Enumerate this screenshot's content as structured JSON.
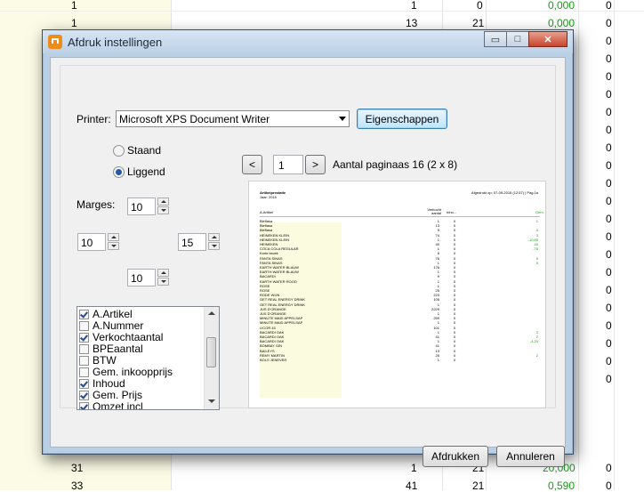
{
  "background": {
    "top_row": {
      "a": "1",
      "b": "1",
      "c": "0",
      "d": "0,000",
      "e": "0"
    },
    "row2": {
      "a": "1",
      "b": "13",
      "c": "21",
      "d": "0,000",
      "e": "0"
    },
    "right_zeros": [
      "0",
      "0",
      "0",
      "0",
      "0",
      "0",
      "0",
      "0",
      "0",
      "0",
      "0",
      "0",
      "0",
      "0",
      "0",
      "0",
      "0",
      "0",
      "0",
      "0"
    ],
    "bottom_row1": {
      "a": "31",
      "b": "1",
      "c": "21",
      "d": "20,000",
      "e": "0"
    },
    "bottom_row2": {
      "a": "33",
      "b": "41",
      "c": "21",
      "d": "0,590",
      "e": "0"
    },
    "green_color": "#1a9a1a"
  },
  "dialog": {
    "title": "Afdruk instellingen",
    "window_buttons": {
      "minimize": "▭",
      "maximize": "□",
      "close": "✕"
    },
    "printer_label": "Printer:",
    "printer_value": "Microsoft XPS Document Writer",
    "properties_button": "Eigenschappen",
    "orientation": {
      "portrait": "Staand",
      "landscape": "Liggend",
      "selected": "Liggend"
    },
    "margins_label": "Marges:",
    "margins": {
      "top": "10",
      "left": "10",
      "right": "15",
      "bottom": "10"
    },
    "columns": [
      {
        "label": "A.Artikel",
        "checked": true
      },
      {
        "label": "A.Nummer",
        "checked": false
      },
      {
        "label": "Verkochtaantal",
        "checked": true
      },
      {
        "label": "BPEaantal",
        "checked": false
      },
      {
        "label": "BTW",
        "checked": false
      },
      {
        "label": "Gem. inkoopprijs",
        "checked": false
      },
      {
        "label": "Inhoud",
        "checked": true
      },
      {
        "label": "Gem. Prijs",
        "checked": true
      },
      {
        "label": "Omzet incl",
        "checked": true
      }
    ],
    "pager": {
      "prev": "<",
      "page": "1",
      "next": ">",
      "page_count_text": "Aantal paginaas 16 (2 x 8)"
    },
    "print_button": "Afdrukken",
    "cancel_button": "Annuleren"
  },
  "preview": {
    "title": "Artikelprestatie",
    "subtitle": "Jaar: 2015",
    "header_right": "Afgedrukt op: 07-09-2015 (12:57) | Pag.1a",
    "col_article": "A.Artikel",
    "col_sold": "Verkocht aantal",
    "col_content": "Inho...",
    "col_avg": "Gem.",
    "rows": [
      {
        "name": "Bieflasa",
        "sold": "1",
        "content": "0",
        "avg": "1"
      },
      {
        "name": "Bieflasa",
        "sold": "13",
        "content": "0",
        "avg": ""
      },
      {
        "name": "Bieflasa",
        "sold": "5",
        "content": "0",
        "avg": "-3"
      },
      {
        "name": "HEINEKEN KLEIN",
        "sold": "74",
        "content": "0",
        "avg": "3"
      },
      {
        "name": "HEINEKEN KLEIN",
        "sold": "1",
        "content": "0",
        "avg": "-10.85"
      },
      {
        "name": "HEINEKEN",
        "sold": "40",
        "content": "0",
        "avg": "-40"
      },
      {
        "name": "COCA COLA REGULAR",
        "sold": "1",
        "content": "0",
        "avg": "-78"
      },
      {
        "name": "Korte broek",
        "sold": "6",
        "content": "0",
        "avg": ""
      },
      {
        "name": "FANTA SINAS",
        "sold": "76",
        "content": "0",
        "avg": "5"
      },
      {
        "name": "FANTA SINAS",
        "sold": "1",
        "content": "0",
        "avg": "5"
      },
      {
        "name": "EARTH WATER BLAUW",
        "sold": "176",
        "content": "0",
        "avg": ""
      },
      {
        "name": "EARTH WATER BLAUW",
        "sold": "1",
        "content": "0",
        "avg": ""
      },
      {
        "name": "BACARDI",
        "sold": "9",
        "content": "0",
        "avg": ""
      },
      {
        "name": "EARTH WATER ROOD",
        "sold": "1",
        "content": "0",
        "avg": ""
      },
      {
        "name": "ROSE",
        "sold": "1",
        "content": "0",
        "avg": ""
      },
      {
        "name": "ROSE",
        "sold": "25",
        "content": "0",
        "avg": ""
      },
      {
        "name": "RODE WIJN",
        "sold": "223",
        "content": "0",
        "avg": ""
      },
      {
        "name": "GET REAL ENERGY DRINK",
        "sold": "105",
        "content": "0",
        "avg": ""
      },
      {
        "name": "GET REAL ENERGY DRINK",
        "sold": "1",
        "content": "0",
        "avg": ""
      },
      {
        "name": "JUS D'ORANGE",
        "sold": "2229",
        "content": "0",
        "avg": ""
      },
      {
        "name": "JUS D'ORANGE",
        "sold": "1",
        "content": "0",
        "avg": ""
      },
      {
        "name": "MINUTE MAID APPELSAP",
        "sold": "259",
        "content": "0",
        "avg": ""
      },
      {
        "name": "MINUTE MAID APPELSAP",
        "sold": "1",
        "content": "0",
        "avg": ""
      },
      {
        "name": "LICOR 43",
        "sold": "101",
        "content": "0",
        "avg": ""
      },
      {
        "name": "BACARDI OAK",
        "sold": "1",
        "content": "0",
        "avg": "2"
      },
      {
        "name": "BACARDI OAK",
        "sold": "41",
        "content": "0",
        "avg": "2"
      },
      {
        "name": "BACARDI OAK",
        "sold": "1",
        "content": "0",
        "avg": "-4.20"
      },
      {
        "name": "BOMBAY GIN",
        "sold": "41",
        "content": "0",
        "avg": ""
      },
      {
        "name": "BAILEYS",
        "sold": "13",
        "content": "0",
        "avg": ""
      },
      {
        "name": "REMY MARTIN",
        "sold": "25",
        "content": "0",
        "avg": "2"
      },
      {
        "name": "BOLS JENEVER",
        "sold": "1",
        "content": "0",
        "avg": ""
      }
    ]
  }
}
